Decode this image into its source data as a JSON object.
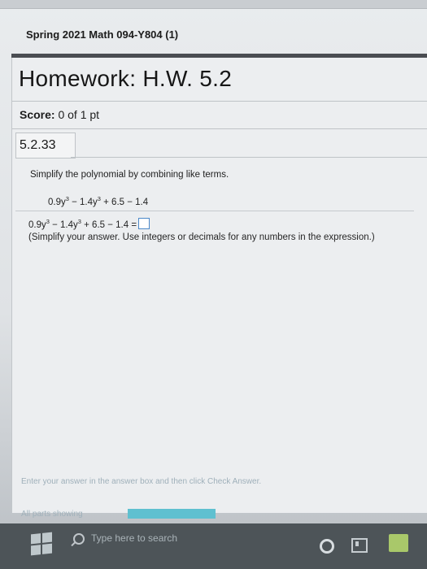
{
  "course": {
    "title": "Spring 2021 Math 094-Y804 (1)"
  },
  "homework": {
    "title": "Homework: H.W. 5.2",
    "score_label": "Score:",
    "score_value": "0 of 1 pt"
  },
  "question": {
    "number": "5.2.33",
    "instruction": "Simplify the polynomial by combining like terms.",
    "expression": {
      "t1": "0.9y",
      "e1": "3",
      "t2": " − 1.4y",
      "e2": "3",
      "t3": " + 6.5 − 1.4"
    },
    "answer_line": {
      "t1": "0.9y",
      "e1": "3",
      "t2": " − 1.4y",
      "e2": "3",
      "t3": " + 6.5 − 1.4 ="
    },
    "hint": "(Simplify your answer. Use integers or decimals for any numbers in the expression.)"
  },
  "footer": {
    "instructions": "Enter your answer in the answer box and then click Check Answer.",
    "parts_label": "All parts showing",
    "progress_fraction": 1.0
  },
  "taskbar": {
    "search_placeholder": "Type here to search",
    "icons": [
      "windows-logo-icon",
      "search-icon",
      "cortana-icon",
      "task-view-icon",
      "app-icon"
    ]
  },
  "colors": {
    "answer_box_border": "#4b88c9",
    "progress_fill": "#5fc0d0",
    "taskbar": "#4d5458"
  }
}
